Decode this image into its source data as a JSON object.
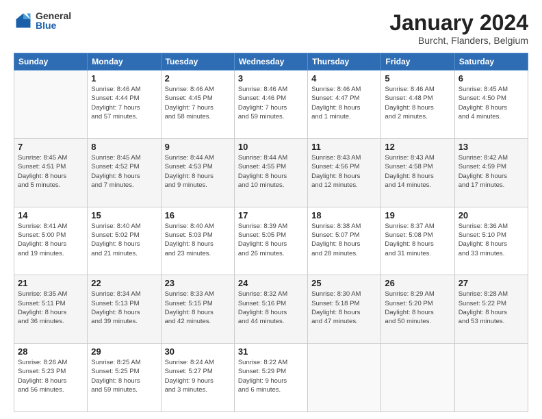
{
  "logo": {
    "general": "General",
    "blue": "Blue"
  },
  "header": {
    "title": "January 2024",
    "subtitle": "Burcht, Flanders, Belgium"
  },
  "weekdays": [
    "Sunday",
    "Monday",
    "Tuesday",
    "Wednesday",
    "Thursday",
    "Friday",
    "Saturday"
  ],
  "weeks": [
    [
      {
        "day": "",
        "info": ""
      },
      {
        "day": "1",
        "info": "Sunrise: 8:46 AM\nSunset: 4:44 PM\nDaylight: 7 hours\nand 57 minutes."
      },
      {
        "day": "2",
        "info": "Sunrise: 8:46 AM\nSunset: 4:45 PM\nDaylight: 7 hours\nand 58 minutes."
      },
      {
        "day": "3",
        "info": "Sunrise: 8:46 AM\nSunset: 4:46 PM\nDaylight: 7 hours\nand 59 minutes."
      },
      {
        "day": "4",
        "info": "Sunrise: 8:46 AM\nSunset: 4:47 PM\nDaylight: 8 hours\nand 1 minute."
      },
      {
        "day": "5",
        "info": "Sunrise: 8:46 AM\nSunset: 4:48 PM\nDaylight: 8 hours\nand 2 minutes."
      },
      {
        "day": "6",
        "info": "Sunrise: 8:45 AM\nSunset: 4:50 PM\nDaylight: 8 hours\nand 4 minutes."
      }
    ],
    [
      {
        "day": "7",
        "info": "Sunrise: 8:45 AM\nSunset: 4:51 PM\nDaylight: 8 hours\nand 5 minutes."
      },
      {
        "day": "8",
        "info": "Sunrise: 8:45 AM\nSunset: 4:52 PM\nDaylight: 8 hours\nand 7 minutes."
      },
      {
        "day": "9",
        "info": "Sunrise: 8:44 AM\nSunset: 4:53 PM\nDaylight: 8 hours\nand 9 minutes."
      },
      {
        "day": "10",
        "info": "Sunrise: 8:44 AM\nSunset: 4:55 PM\nDaylight: 8 hours\nand 10 minutes."
      },
      {
        "day": "11",
        "info": "Sunrise: 8:43 AM\nSunset: 4:56 PM\nDaylight: 8 hours\nand 12 minutes."
      },
      {
        "day": "12",
        "info": "Sunrise: 8:43 AM\nSunset: 4:58 PM\nDaylight: 8 hours\nand 14 minutes."
      },
      {
        "day": "13",
        "info": "Sunrise: 8:42 AM\nSunset: 4:59 PM\nDaylight: 8 hours\nand 17 minutes."
      }
    ],
    [
      {
        "day": "14",
        "info": "Sunrise: 8:41 AM\nSunset: 5:00 PM\nDaylight: 8 hours\nand 19 minutes."
      },
      {
        "day": "15",
        "info": "Sunrise: 8:40 AM\nSunset: 5:02 PM\nDaylight: 8 hours\nand 21 minutes."
      },
      {
        "day": "16",
        "info": "Sunrise: 8:40 AM\nSunset: 5:03 PM\nDaylight: 8 hours\nand 23 minutes."
      },
      {
        "day": "17",
        "info": "Sunrise: 8:39 AM\nSunset: 5:05 PM\nDaylight: 8 hours\nand 26 minutes."
      },
      {
        "day": "18",
        "info": "Sunrise: 8:38 AM\nSunset: 5:07 PM\nDaylight: 8 hours\nand 28 minutes."
      },
      {
        "day": "19",
        "info": "Sunrise: 8:37 AM\nSunset: 5:08 PM\nDaylight: 8 hours\nand 31 minutes."
      },
      {
        "day": "20",
        "info": "Sunrise: 8:36 AM\nSunset: 5:10 PM\nDaylight: 8 hours\nand 33 minutes."
      }
    ],
    [
      {
        "day": "21",
        "info": "Sunrise: 8:35 AM\nSunset: 5:11 PM\nDaylight: 8 hours\nand 36 minutes."
      },
      {
        "day": "22",
        "info": "Sunrise: 8:34 AM\nSunset: 5:13 PM\nDaylight: 8 hours\nand 39 minutes."
      },
      {
        "day": "23",
        "info": "Sunrise: 8:33 AM\nSunset: 5:15 PM\nDaylight: 8 hours\nand 42 minutes."
      },
      {
        "day": "24",
        "info": "Sunrise: 8:32 AM\nSunset: 5:16 PM\nDaylight: 8 hours\nand 44 minutes."
      },
      {
        "day": "25",
        "info": "Sunrise: 8:30 AM\nSunset: 5:18 PM\nDaylight: 8 hours\nand 47 minutes."
      },
      {
        "day": "26",
        "info": "Sunrise: 8:29 AM\nSunset: 5:20 PM\nDaylight: 8 hours\nand 50 minutes."
      },
      {
        "day": "27",
        "info": "Sunrise: 8:28 AM\nSunset: 5:22 PM\nDaylight: 8 hours\nand 53 minutes."
      }
    ],
    [
      {
        "day": "28",
        "info": "Sunrise: 8:26 AM\nSunset: 5:23 PM\nDaylight: 8 hours\nand 56 minutes."
      },
      {
        "day": "29",
        "info": "Sunrise: 8:25 AM\nSunset: 5:25 PM\nDaylight: 8 hours\nand 59 minutes."
      },
      {
        "day": "30",
        "info": "Sunrise: 8:24 AM\nSunset: 5:27 PM\nDaylight: 9 hours\nand 3 minutes."
      },
      {
        "day": "31",
        "info": "Sunrise: 8:22 AM\nSunset: 5:29 PM\nDaylight: 9 hours\nand 6 minutes."
      },
      {
        "day": "",
        "info": ""
      },
      {
        "day": "",
        "info": ""
      },
      {
        "day": "",
        "info": ""
      }
    ]
  ]
}
